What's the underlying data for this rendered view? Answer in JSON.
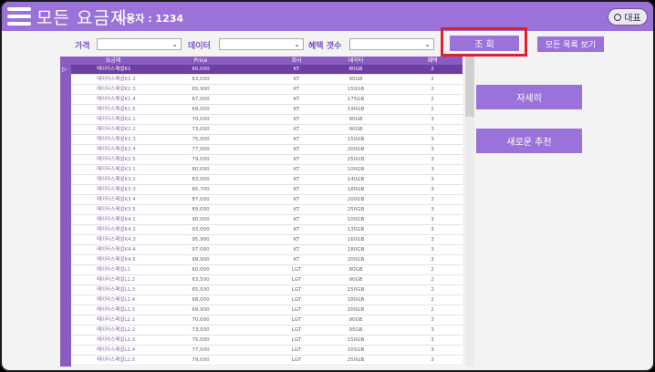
{
  "header": {
    "title": "모든 요금제",
    "user_label": "사용자 : 1234",
    "rep_button": "대표"
  },
  "filters": {
    "price_label": "가격",
    "data_label": "데이터",
    "benefit_label": "혜택 갯수"
  },
  "buttons": {
    "query": "조 회",
    "all_list": "모든 목록 보기",
    "detail": "자세히",
    "recommend": "새로운 추천"
  },
  "table": {
    "columns": [
      "요금제",
      "Price",
      "회사",
      "데이터",
      "혜택"
    ],
    "rows": [
      [
        "메이타스페셜K1",
        "60,000",
        "KT",
        "80GB",
        "2"
      ],
      [
        "메이타스페셜K1.2",
        "63,000",
        "KT",
        "90GB",
        "2"
      ],
      [
        "메이타스페셜K1.3",
        "65,900",
        "KT",
        "150GB",
        "2"
      ],
      [
        "메이타스페셜K1.4",
        "67,000",
        "KT",
        "175GB",
        "2"
      ],
      [
        "메이타스페셜K1.5",
        "69,000",
        "KT",
        "190GB",
        "2"
      ],
      [
        "메이타스페셜K2.1",
        "70,000",
        "KT",
        "90GB",
        "3"
      ],
      [
        "메이타스페셜K2.2",
        "73,000",
        "KT",
        "90GB",
        "3"
      ],
      [
        "메이타스페셜K2.3",
        "75,900",
        "KT",
        "150GB",
        "3"
      ],
      [
        "메이타스페셜K2.4",
        "77,000",
        "KT",
        "200GB",
        "3"
      ],
      [
        "메이타스페셜K2.5",
        "79,000",
        "KT",
        "250GB",
        "3"
      ],
      [
        "메이타스페셜K3.1",
        "80,000",
        "KT",
        "100GB",
        "3"
      ],
      [
        "메이타스페셜K3.2",
        "83,000",
        "KT",
        "140GB",
        "3"
      ],
      [
        "메이타스페셜K3.3",
        "85,700",
        "KT",
        "180GB",
        "3"
      ],
      [
        "메이타스페셜K3.4",
        "87,000",
        "KT",
        "200GB",
        "3"
      ],
      [
        "메이타스페셜K3.5",
        "89,000",
        "KT",
        "250GB",
        "3"
      ],
      [
        "메이타스페셜K4.1",
        "90,000",
        "KT",
        "100GB",
        "3"
      ],
      [
        "메이타스페셜K4.2",
        "93,000",
        "KT",
        "130GB",
        "3"
      ],
      [
        "메이타스페셜K4.3",
        "95,900",
        "KT",
        "160GB",
        "3"
      ],
      [
        "메이타스페셜K4.4",
        "97,000",
        "KT",
        "180GB",
        "3"
      ],
      [
        "메이타스페셜K4.5",
        "99,900",
        "KT",
        "200GB",
        "3"
      ],
      [
        "메이타스페셜L1",
        "60,000",
        "LGT",
        "80GB",
        "2"
      ],
      [
        "메이타스페셜L1.2",
        "63,500",
        "LGT",
        "90GB",
        "2"
      ],
      [
        "메이타스페셜L1.3",
        "65,500",
        "LGT",
        "150GB",
        "2"
      ],
      [
        "메이타스페셜L1.4",
        "68,000",
        "LGT",
        "180GB",
        "2"
      ],
      [
        "메이타스페셜L1.5",
        "69,900",
        "LGT",
        "200GB",
        "2"
      ],
      [
        "메이타스페셜L2.1",
        "70,000",
        "LGT",
        "90GB",
        "3"
      ],
      [
        "메이타스페셜L2.2",
        "73,500",
        "LGT",
        "95GB",
        "3"
      ],
      [
        "메이타스페셜L2.3",
        "75,500",
        "LGT",
        "150GB",
        "3"
      ],
      [
        "메이타스페셜L2.4",
        "77,500",
        "LGT",
        "205GB",
        "3"
      ],
      [
        "메이타스페셜L2.5",
        "79,000",
        "LGT",
        "250GB",
        "3"
      ]
    ]
  },
  "colors": {
    "accent": "#9b72d9",
    "grid_header": "#8a5bc0",
    "selected_row": "#6b3fa3",
    "highlight": "#e0202a"
  },
  "icons": [
    "menu-icon",
    "chevron-down-icon",
    "circle-icon",
    "row-pointer-icon"
  ]
}
